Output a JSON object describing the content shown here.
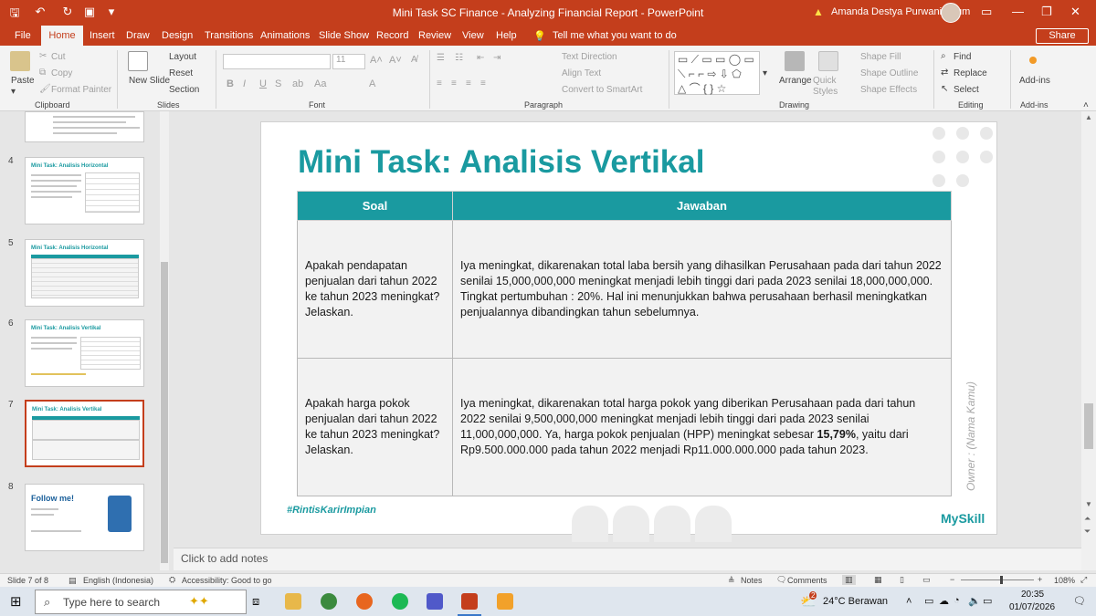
{
  "titlebar": {
    "title": "Mini Task SC Finance - Analyzing Financial Report  -  PowerPoint",
    "user": "Amanda Destya Purwaningrum"
  },
  "menu": {
    "tabs": [
      "File",
      "Home",
      "Insert",
      "Draw",
      "Design",
      "Transitions",
      "Animations",
      "Slide Show",
      "Record",
      "Review",
      "View",
      "Help"
    ],
    "tell_me": "Tell me what you want to do",
    "share": "Share"
  },
  "ribbon": {
    "clipboard": {
      "paste": "Paste",
      "cut": "Cut",
      "copy": "Copy",
      "format_painter": "Format Painter",
      "label": "Clipboard"
    },
    "slides": {
      "new_slide": "New Slide",
      "layout": "Layout",
      "reset": "Reset",
      "section": "Section",
      "label": "Slides"
    },
    "font": {
      "size": "11",
      "label": "Font"
    },
    "paragraph": {
      "text_direction": "Text Direction",
      "align_text": "Align Text",
      "convert": "Convert to SmartArt",
      "label": "Paragraph"
    },
    "drawing": {
      "arrange": "Arrange",
      "quick_styles": "Quick Styles",
      "shape_fill": "Shape Fill",
      "shape_outline": "Shape Outline",
      "shape_effects": "Shape Effects",
      "label": "Drawing"
    },
    "editing": {
      "find": "Find",
      "replace": "Replace",
      "select": "Select",
      "label": "Editing"
    },
    "addins": {
      "addins": "Add-ins",
      "label": "Add-ins"
    }
  },
  "thumbnails": [
    {
      "num": "4",
      "title": "Mini Task: Analisis Horizontal"
    },
    {
      "num": "5",
      "title": "Mini Task: Analisis Horizontal"
    },
    {
      "num": "6",
      "title": "Mini Task: Analisis Vertikal"
    },
    {
      "num": "7",
      "title": "Mini Task: Analisis Vertikal"
    },
    {
      "num": "8",
      "title": "Follow me!"
    }
  ],
  "slide": {
    "title": "Mini Task: Analisis Vertikal",
    "headers": [
      "Soal",
      "Jawaban"
    ],
    "rows": [
      {
        "q": "Apakah pendapatan penjualan dari tahun 2022 ke tahun 2023 meningkat? Jelaskan.",
        "a": "Iya meningkat, dikarenakan total laba bersih yang dihasilkan Perusahaan pada dari tahun 2022 senilai 15,000,000,000 meningkat menjadi lebih tinggi dari pada 2023 senilai 18,000,000,000. Tingkat pertumbuhan : 20%. Hal ini menunjukkan bahwa perusahaan berhasil meningkatkan penjualannya dibandingkan tahun sebelumnya."
      },
      {
        "q": "Apakah harga pokok penjualan dari tahun 2022 ke tahun 2023 meningkat? Jelaskan.",
        "a_pre": "Iya meningkat, dikarenakan total harga pokok yang diberikan Perusahaan pada dari tahun 2022 senilai 9,500,000,000 meningkat menjadi lebih tinggi dari pada 2023 senilai 11,000,000,000. Ya, harga pokok penjualan (HPP) meningkat sebesar ",
        "a_bold": "15,79%",
        "a_post": ", yaitu dari Rp9.500.000.000 pada tahun 2022 menjadi Rp11.000.000.000 pada tahun 2023."
      }
    ],
    "hashtag": "#RintisKarirImpian",
    "logo": "MySkill",
    "owner": "Owner : (Nama Kamu)"
  },
  "notes": "Click to add notes",
  "status": {
    "slide": "Slide 7 of 8",
    "language": "English (Indonesia)",
    "accessibility": "Accessibility: Good to go",
    "notes": "Notes",
    "comments": "Comments",
    "zoom": "108%"
  },
  "taskbar": {
    "search": "Type here to search",
    "weather": "24°C  Berawan",
    "time": "20:35",
    "date": "01/07/2026",
    "badge": "2"
  }
}
